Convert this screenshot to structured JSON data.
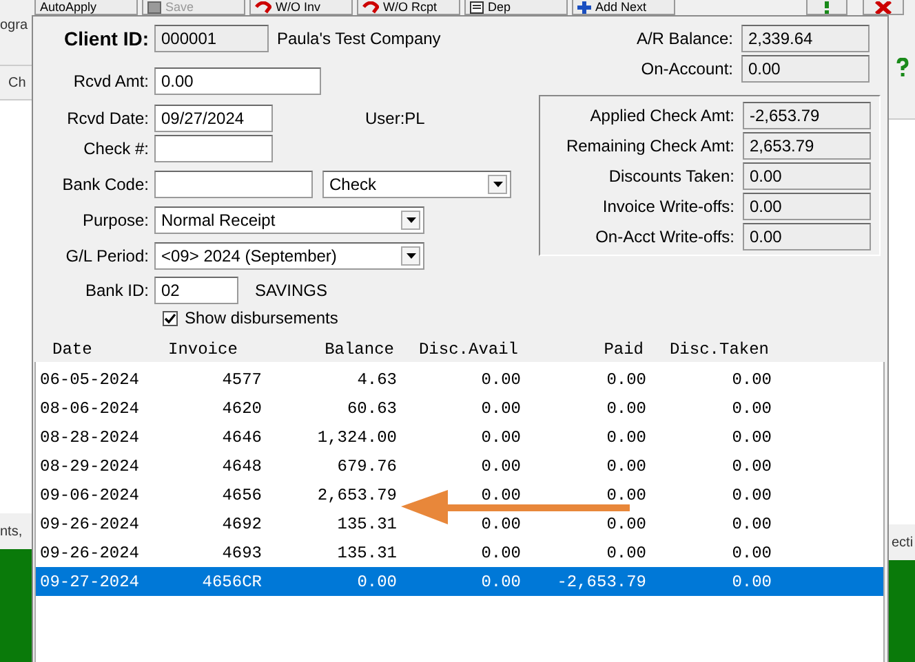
{
  "background": {
    "left_texts": [
      "ogra",
      "Ch",
      "nts,"
    ],
    "right_texts": [
      "ecti"
    ]
  },
  "toolbar": [
    {
      "label": "AutoApply",
      "kind": "plain",
      "disabled": false
    },
    {
      "label": "Save",
      "kind": "disk",
      "disabled": true
    },
    {
      "label": "W/O Inv",
      "kind": "undo",
      "disabled": false
    },
    {
      "label": "W/O Rcpt",
      "kind": "undo",
      "disabled": false
    },
    {
      "label": "Dep",
      "kind": "doc",
      "disabled": false
    },
    {
      "label": "Add Next",
      "kind": "plus",
      "disabled": false
    }
  ],
  "client_id": {
    "label": "Client ID:",
    "value": "000001",
    "name": "Paula's Test Company"
  },
  "ar_balance": {
    "label": "A/R Balance:",
    "value": "2,339.64"
  },
  "on_account": {
    "label": "On-Account:",
    "value": "0.00"
  },
  "rcvd_amt": {
    "label": "Rcvd Amt:",
    "value": "0.00"
  },
  "rcvd_date": {
    "label": "Rcvd Date:",
    "value": "09/27/2024"
  },
  "user": "User:PL",
  "check_no": {
    "label": "Check #:"
  },
  "bank_code": {
    "label": "Bank Code:"
  },
  "payment_type": {
    "value": "Check"
  },
  "purpose": {
    "label": "Purpose:",
    "value": "Normal Receipt"
  },
  "gl_period": {
    "label": "G/L Period:",
    "value": "<09> 2024 (September)"
  },
  "bank_id": {
    "label": "Bank ID:",
    "value": "02",
    "name": "SAVINGS"
  },
  "show_disbursements": {
    "label": "Show disbursements",
    "checked": true
  },
  "totals": [
    {
      "label": "Applied Check Amt:",
      "value": "-2,653.79"
    },
    {
      "label": "Remaining Check Amt:",
      "value": "2,653.79"
    },
    {
      "label": "Discounts Taken:",
      "value": "0.00"
    },
    {
      "label": "Invoice Write-offs:",
      "value": "0.00"
    },
    {
      "label": "On-Acct Write-offs:",
      "value": "0.00"
    }
  ],
  "table": {
    "columns": [
      "Date",
      "Invoice",
      "Balance",
      "Disc.Avail",
      "Paid",
      "Disc.Taken"
    ],
    "rows": [
      {
        "cells": [
          "06-05-2024",
          "4577",
          "4.63",
          "0.00",
          "0.00",
          "0.00"
        ],
        "selected": false
      },
      {
        "cells": [
          "08-06-2024",
          "4620",
          "60.63",
          "0.00",
          "0.00",
          "0.00"
        ],
        "selected": false
      },
      {
        "cells": [
          "08-28-2024",
          "4646",
          "1,324.00",
          "0.00",
          "0.00",
          "0.00"
        ],
        "selected": false
      },
      {
        "cells": [
          "08-29-2024",
          "4648",
          "679.76",
          "0.00",
          "0.00",
          "0.00"
        ],
        "selected": false
      },
      {
        "cells": [
          "09-06-2024",
          "4656",
          "2,653.79",
          "0.00",
          "0.00",
          "0.00"
        ],
        "selected": false
      },
      {
        "cells": [
          "09-26-2024",
          "4692",
          "135.31",
          "0.00",
          "0.00",
          "0.00"
        ],
        "selected": false
      },
      {
        "cells": [
          "09-26-2024",
          "4693",
          "135.31",
          "0.00",
          "0.00",
          "0.00"
        ],
        "selected": false
      },
      {
        "cells": [
          "09-27-2024",
          "4656CR",
          "0.00",
          "0.00",
          "-2,653.79",
          "0.00"
        ],
        "selected": true
      }
    ]
  }
}
